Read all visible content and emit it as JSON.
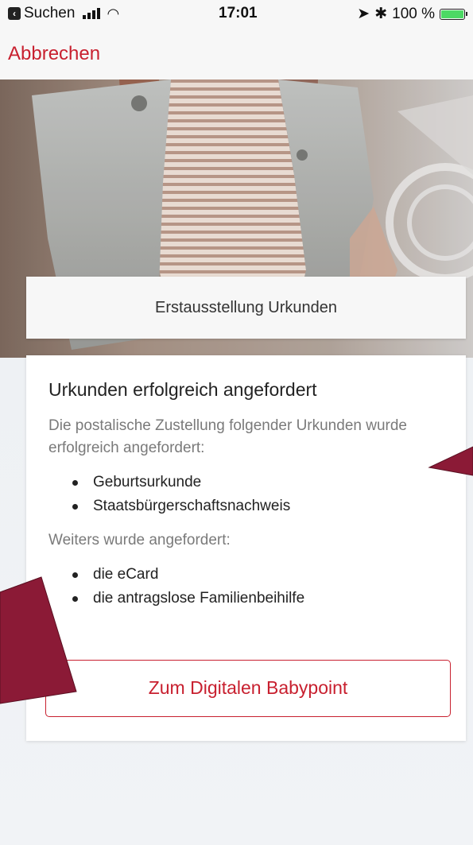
{
  "status_bar": {
    "back_label": "Suchen",
    "back_icon": "back-to-app-icon",
    "time": "17:01",
    "battery_text": "100 %",
    "location_icon": "location-arrow-icon",
    "bluetooth_icon": "bluetooth-icon"
  },
  "nav": {
    "cancel_label": "Abbrechen"
  },
  "title_card": {
    "title": "Erstausstellung Urkunden"
  },
  "content": {
    "heading": "Urkunden erfolgreich angefordert",
    "intro_text": "Die postalische Zustellung folgender Urkunden wurde erfolgreich angefordert:",
    "requested_documents": [
      "Geburtsurkunde",
      "Staatsbürgerschaftsnachweis"
    ],
    "further_text": "Weiters wurde angefordert:",
    "further_items": [
      "die eCard",
      "die antragslose Familienbeihilfe"
    ],
    "cta_label": "Zum Digitalen Babypoint"
  },
  "colors": {
    "accent": "#c8202f",
    "annotation_arrow": "#8b1a36",
    "battery_fill": "#4cd964"
  }
}
